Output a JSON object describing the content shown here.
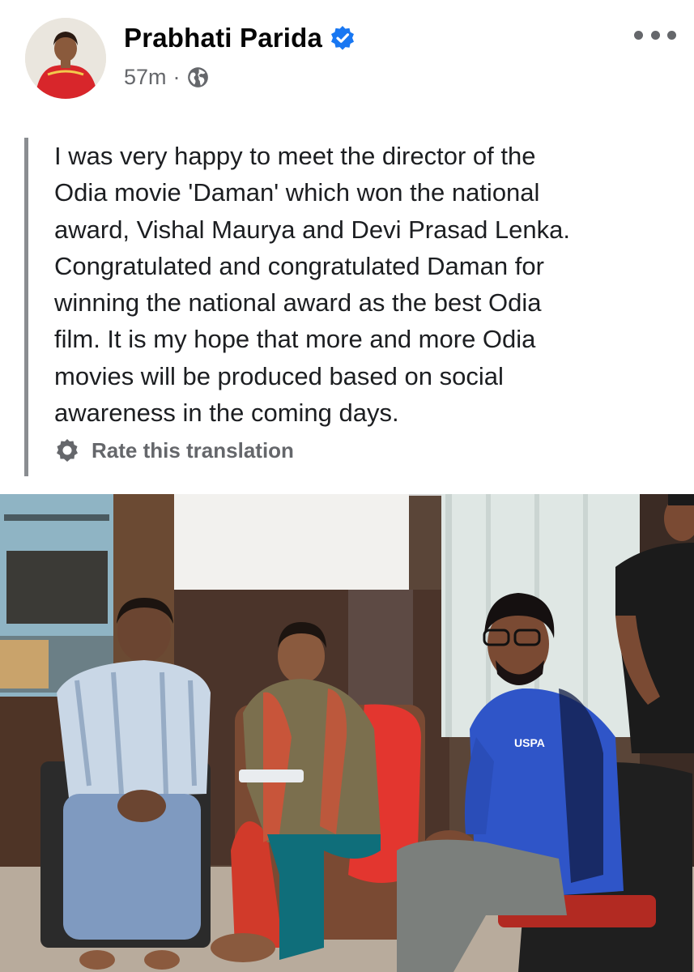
{
  "post": {
    "author": "Prabhati Parida",
    "verified": true,
    "time": "57m",
    "separator": "·",
    "audience_icon": "globe-icon",
    "more_icon": "more-options-icon",
    "text_lines": [
      "I was very happy to meet the director of the",
      "Odia movie 'Daman' which won the national",
      "award, Vishal Maurya and Devi Prasad Lenka.",
      "Congratulated and congratulated Daman for",
      "winning the national award as the best Odia",
      "film. It is my hope that more and more Odia",
      "movies will be produced based on social",
      "awareness in the coming days."
    ],
    "rate_translation": "Rate this translation",
    "photo_shirt_text": "USPA"
  },
  "colors": {
    "verified_blue": "#1877f2",
    "secondary_text": "#65676b",
    "quote_bar": "#8a8d91"
  }
}
